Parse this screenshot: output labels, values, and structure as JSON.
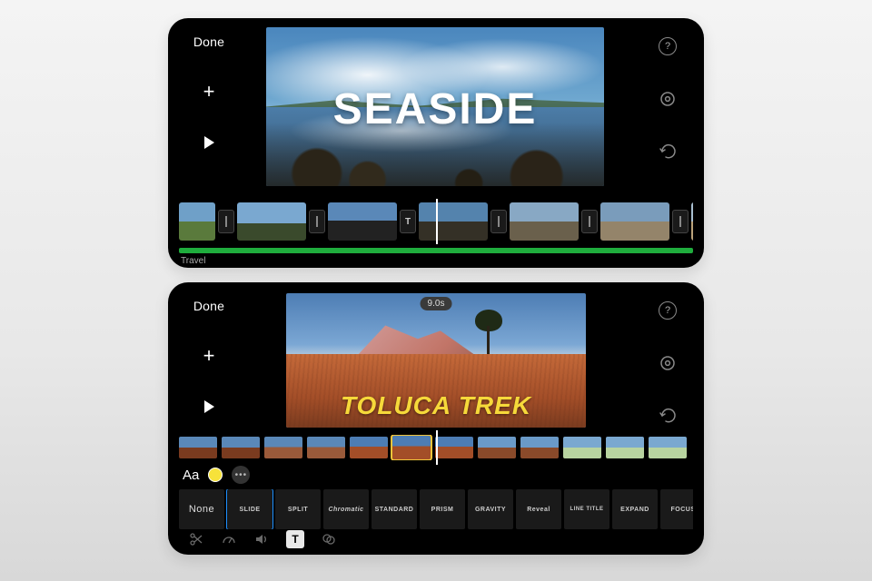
{
  "device1": {
    "left": {
      "done": "Done",
      "plus": "+",
      "play": "play"
    },
    "right": {
      "help": "?",
      "settings": "settings",
      "undo": "undo"
    },
    "preview": {
      "title": "SEASIDE"
    },
    "timeline": {
      "track_label": "Travel",
      "clips": [
        "sk1",
        "sk2",
        "sk3",
        "sk4",
        "sk5",
        "sk6",
        "sk7"
      ]
    }
  },
  "device2": {
    "left": {
      "done": "Done",
      "plus": "+",
      "play": "play"
    },
    "right": {
      "help": "?",
      "settings": "settings",
      "undo": "undo"
    },
    "preview": {
      "title": "TOLUCA TREK",
      "duration": "9.0s"
    },
    "text_controls": {
      "font": "Aa",
      "color": "#f7e23a",
      "more": "•••"
    },
    "title_styles": {
      "selected_index": 1,
      "items": [
        "None",
        "SLIDE",
        "SPLIT",
        "Chromatic",
        "STANDARD",
        "PRISM",
        "GRAVITY",
        "Reveal",
        "LINE TITLE",
        "EXPAND",
        "FOCUS"
      ]
    },
    "bottom_toolbar": {
      "active": "title",
      "items": [
        "scissors",
        "speed",
        "volume",
        "title",
        "filters"
      ]
    }
  }
}
